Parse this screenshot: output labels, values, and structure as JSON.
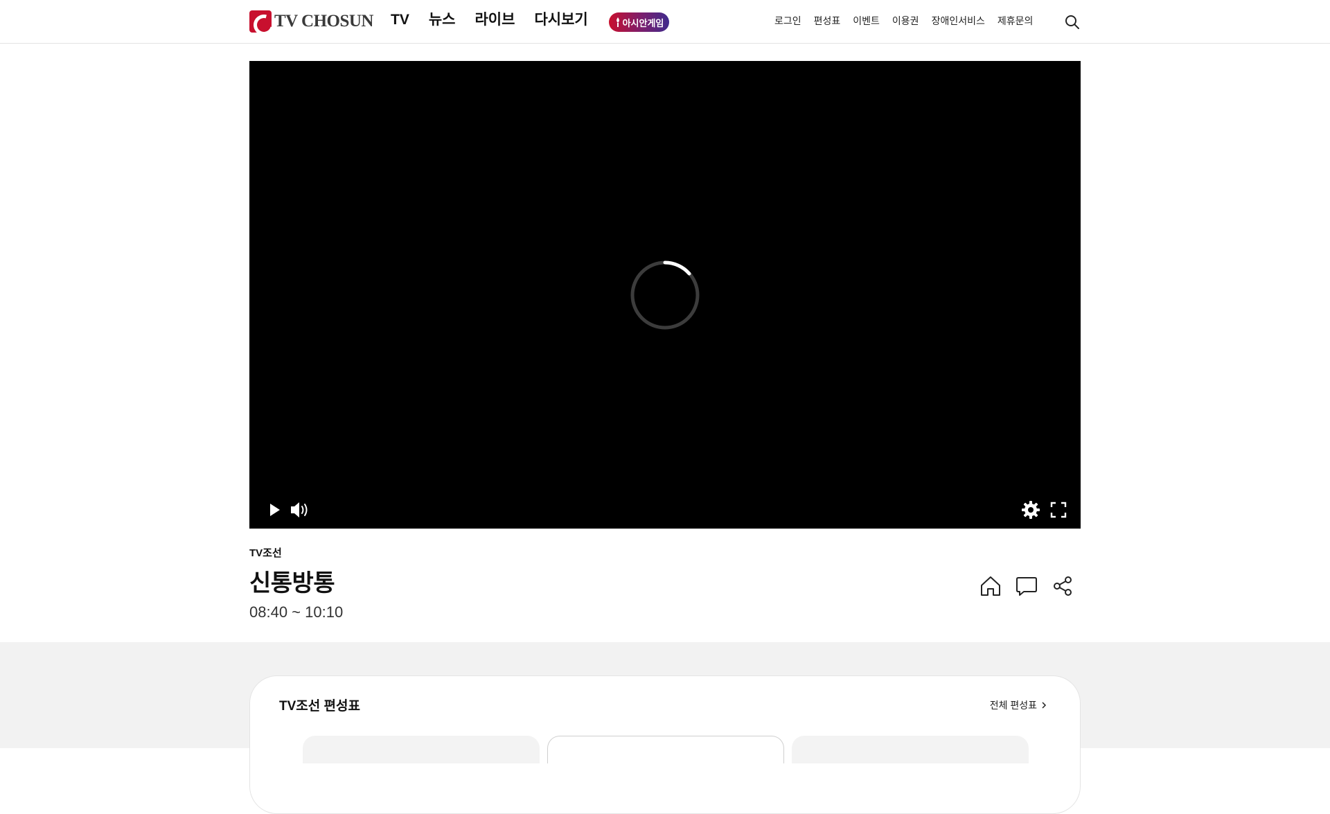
{
  "header": {
    "logo_text": "TV CHOSUN",
    "main_nav": [
      "TV",
      "뉴스",
      "라이브",
      "다시보기"
    ],
    "asian_games_badge": "아시안게임",
    "util_nav": [
      "로그인",
      "편성표",
      "이벤트",
      "이용권",
      "장애인서비스",
      "제휴문의"
    ]
  },
  "player": {
    "state": "loading",
    "controls_left": [
      "play-icon",
      "volume-icon"
    ],
    "controls_right": [
      "settings-icon",
      "fullscreen-icon"
    ]
  },
  "program": {
    "channel": "TV조선",
    "title": "신통방통",
    "time": "08:40 ~ 10:10",
    "actions": [
      "home-icon",
      "comment-icon",
      "share-icon"
    ]
  },
  "schedule": {
    "title": "TV조선 편성표",
    "all_link": "전체 편성표"
  },
  "colors": {
    "brand_red": "#c8102e",
    "badge_gradient_end": "#3f2b8c",
    "player_bg": "#000000",
    "section_bg": "#f2f2f2"
  }
}
